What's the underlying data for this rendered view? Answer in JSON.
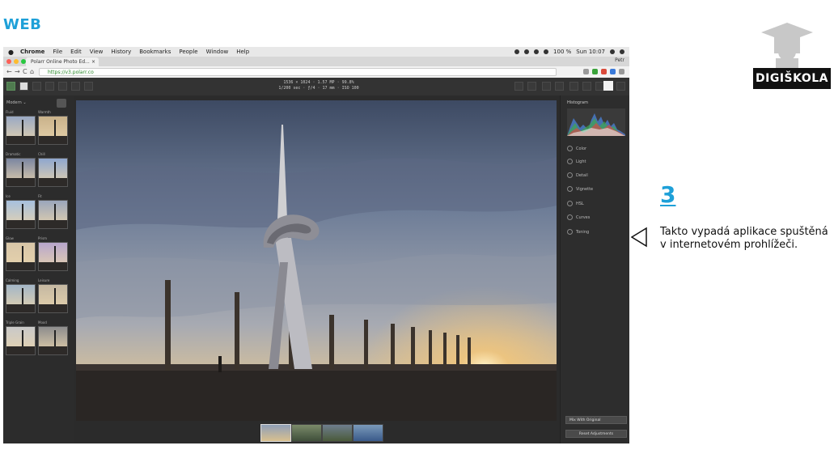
{
  "header": {
    "section": "WEB"
  },
  "badge": {
    "label": "DIGIŠKOLA"
  },
  "caption": {
    "number": "3",
    "text": "Takto vypadá aplikace spuštěná v internetovém prohlížeči."
  },
  "browser": {
    "menu": [
      "Chrome",
      "File",
      "Edit",
      "View",
      "History",
      "Bookmarks",
      "People",
      "Window",
      "Help"
    ],
    "clock": "Sun 10:07",
    "battery": "100 %",
    "tab_title": "Polarr Online Photo Ed...",
    "tab_close": "×",
    "user": "Petr",
    "url": "https://v3.polarr.co",
    "back": "←",
    "forward": "→",
    "reload": "C",
    "home": "⌂"
  },
  "app": {
    "info_line1": "1536 × 1024 · 1.57 MP · 99.8%",
    "info_line2": "1/200 sec · ƒ/4 · 17 mm · ISO 100",
    "left": {
      "preset_select": "Modern ⌄",
      "presets": [
        {
          "name": "Fluid",
          "sky": "#9aa9c4"
        },
        {
          "name": "Warmth",
          "sky": "#c9b28a"
        },
        {
          "name": "Dramatic",
          "sky": "#7b86a1"
        },
        {
          "name": "Chill",
          "sky": "#8fa7cf"
        },
        {
          "name": "Ice",
          "sky": "#a7c0de"
        },
        {
          "name": "Fit",
          "sky": "#9ba6bc"
        },
        {
          "name": "Glow",
          "sky": "#d8c6a8"
        },
        {
          "name": "Prism",
          "sky": "#b8a6cd"
        },
        {
          "name": "Calming",
          "sky": "#a3b6c7"
        },
        {
          "name": "Leisure",
          "sky": "#c4b8a2"
        },
        {
          "name": "Triple Grain",
          "sky": "#c9c9c9"
        },
        {
          "name": "Mood",
          "sky": "#8d8d8d"
        }
      ]
    },
    "right": {
      "histogram_label": "Histogram",
      "adjustments": [
        "Color",
        "Light",
        "Detail",
        "Vignette",
        "HSL",
        "Curves",
        "Toning"
      ],
      "compare_button": "Mix With Original",
      "reset_button": "Reset Adjustments"
    }
  },
  "colors": {
    "accent": "#1ea0d8",
    "app_bg": "#2b2b2b"
  }
}
